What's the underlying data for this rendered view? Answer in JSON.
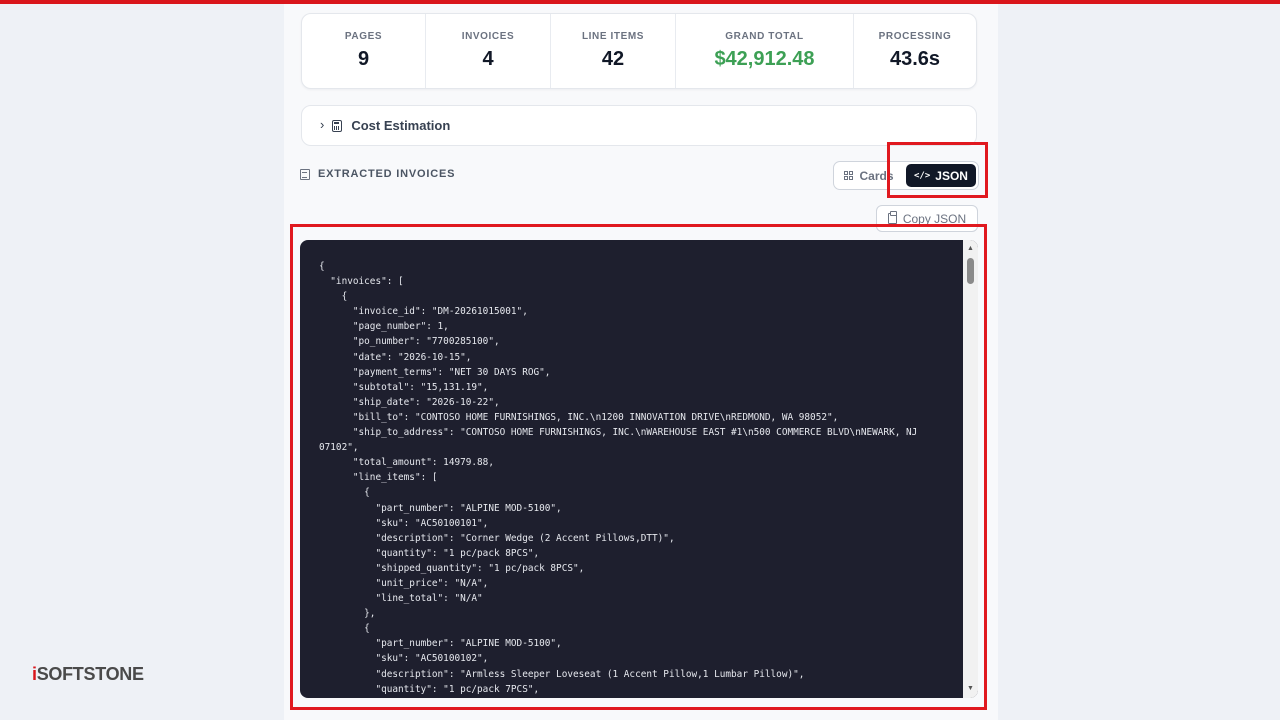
{
  "brand": {
    "name_i": "i",
    "name_rest": "SOFTSTONE"
  },
  "stats": [
    {
      "label": "PAGES",
      "value": "9",
      "color": "#111827"
    },
    {
      "label": "INVOICES",
      "value": "4",
      "color": "#111827"
    },
    {
      "label": "LINE ITEMS",
      "value": "42",
      "color": "#111827"
    },
    {
      "label": "GRAND TOTAL",
      "value": "$42,912.48",
      "color": "#3da055"
    },
    {
      "label": "PROCESSING",
      "value": "43.6s",
      "color": "#111827"
    }
  ],
  "cost_estimation": {
    "title": "Cost Estimation",
    "expanded": false,
    "icon": "calculator-icon"
  },
  "section": {
    "title": "EXTRACTED INVOICES",
    "icon": "document-icon"
  },
  "view_toggle": {
    "cards_label": "Cards",
    "json_label": "JSON",
    "active": "JSON"
  },
  "copy_button": {
    "label": "Copy JSON",
    "icon": "clipboard-icon"
  },
  "json_lines": [
    "{",
    "  \"invoices\": [",
    "    {",
    "      \"invoice_id\": \"DM-20261015001\",",
    "      \"page_number\": 1,",
    "      \"po_number\": \"7700285100\",",
    "      \"date\": \"2026-10-15\",",
    "      \"payment_terms\": \"NET 30 DAYS ROG\",",
    "      \"subtotal\": \"15,131.19\",",
    "      \"ship_date\": \"2026-10-22\",",
    "      \"bill_to\": \"CONTOSO HOME FURNISHINGS, INC.\\n1200 INNOVATION DRIVE\\nREDMOND, WA 98052\",",
    "      \"ship_to_address\": \"CONTOSO HOME FURNISHINGS, INC.\\nWAREHOUSE EAST #1\\n500 COMMERCE BLVD\\nNEWARK, NJ",
    "07102\",",
    "      \"total_amount\": 14979.88,",
    "      \"line_items\": [",
    "        {",
    "          \"part_number\": \"ALPINE MOD-5100\",",
    "          \"sku\": \"AC50100101\",",
    "          \"description\": \"Corner Wedge (2 Accent Pillows,DTT)\",",
    "          \"quantity\": \"1 pc/pack 8PCS\",",
    "          \"shipped_quantity\": \"1 pc/pack 8PCS\",",
    "          \"unit_price\": \"N/A\",",
    "          \"line_total\": \"N/A\"",
    "        },",
    "        {",
    "          \"part_number\": \"ALPINE MOD-5100\",",
    "          \"sku\": \"AC50100102\",",
    "          \"description\": \"Armless Sleeper Loveseat (1 Accent Pillow,1 Lumbar Pillow)\",",
    "          \"quantity\": \"1 pc/pack 7PCS\","
  ],
  "colors": {
    "accent_red": "#d9151b",
    "grand_total_green": "#3da055",
    "code_bg": "#1e1f2e",
    "active_toggle": "#111827"
  }
}
